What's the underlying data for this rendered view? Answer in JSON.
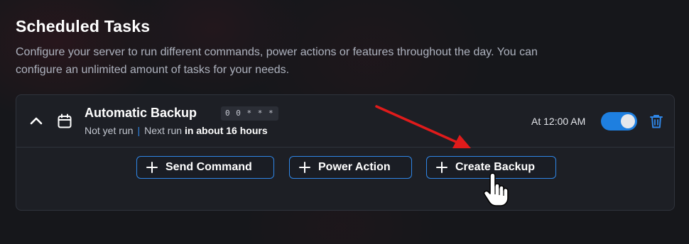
{
  "page": {
    "title": "Scheduled Tasks",
    "description": "Configure your server to run different commands, power actions or features throughout the day. You can configure an unlimited amount of tasks for your needs."
  },
  "task": {
    "name": "Automatic Backup",
    "cron": "0 0 * * *",
    "last_run": "Not yet run",
    "separator": "|",
    "next_run_label": "Next run",
    "next_run_value": "in about 16 hours",
    "time": "At 12:00 AM",
    "enabled": true,
    "expanded": true
  },
  "actions": {
    "send_command": "Send Command",
    "power_action": "Power Action",
    "create_backup": "Create Backup"
  },
  "colors": {
    "accent": "#1e7fe0",
    "delete": "#2f86e6",
    "annotation_arrow": "#e01b1b"
  },
  "icons": {
    "collapse": "chevron-up-icon",
    "schedule": "calendar-icon",
    "delete": "trash-icon",
    "add": "plus-icon",
    "cursor": "hand-pointer-icon",
    "annotation": "red-arrow-icon"
  }
}
